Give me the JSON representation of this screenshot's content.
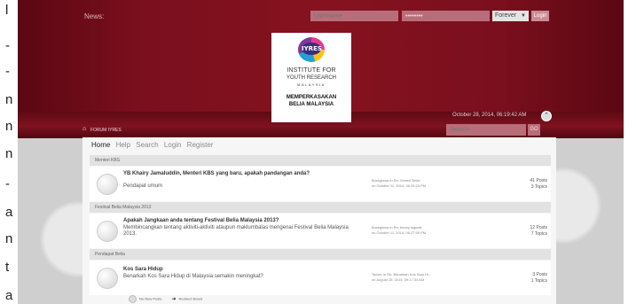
{
  "left_strip_chars": [
    "l",
    "-",
    "-",
    "n",
    "n",
    "n",
    "-",
    "a",
    "n",
    "t",
    "a"
  ],
  "header": {
    "news_label": "News:",
    "username_placeholder": "Username",
    "password_value": "••••••••",
    "remember_select": "Forever",
    "login_label": "Login"
  },
  "logo": {
    "mark_text": "IYRES",
    "line1": "INSTITUTE FOR",
    "line2": "YOUTH RESEARCH",
    "line3": "MALAYSIA",
    "line4": "MEMPERKASAKAN",
    "line5": "BELIA MALAYSIA"
  },
  "date": "October 28, 2014, 06:19:42 AM",
  "breadcrumb": "FORUM IYRES",
  "search": {
    "placeholder": "Search",
    "go_label": "GO"
  },
  "nav": [
    "Home",
    "Help",
    "Search",
    "Login",
    "Register"
  ],
  "categories": [
    {
      "name": "Menteri KBS",
      "boards": [
        {
          "title": "YB Khairy Jamaluddin, Menteri KBS yang baru, apakah pandangan anda?",
          "desc": "Pendapat umum",
          "last_line1": "Boskglowa in Re: Simbol Belia",
          "last_line2": "on October 11, 2014, 06:23:23 PM",
          "posts": "41 Posts",
          "topics": "3 Topics"
        }
      ]
    },
    {
      "name": "Festival Belia Malaysia 2013",
      "boards": [
        {
          "title": "Apakah Jangkaan anda tentang Festival Belia Malaysia 2013?",
          "desc": "Membincangkan tentang aktiviti-aktiviti ataupun maklumbalas mengenai Festival Belia Malaysia 2013.",
          "last_line1": "Boskglowa in Re: binary signals",
          "last_line2": "on October 11, 2014, 06:27:59 PM",
          "posts": "12 Posts",
          "topics": "7 Topics"
        }
      ]
    },
    {
      "name": "Pendapat Belia",
      "boards": [
        {
          "title": "Kos Sara Hidup",
          "desc": "Benarkah Kos Sara Hidup di Malaysia semakin meningkat?",
          "last_line1": "Tazzer in Re: Benarkah Kos Sara Hi...",
          "last_line2": "on August 15, 2014, 09:17:34 AM",
          "posts": "3 Posts",
          "topics": "1 Topics"
        }
      ]
    }
  ],
  "legend": {
    "no_new": "No New Posts",
    "redirect": "Redirect Board"
  }
}
